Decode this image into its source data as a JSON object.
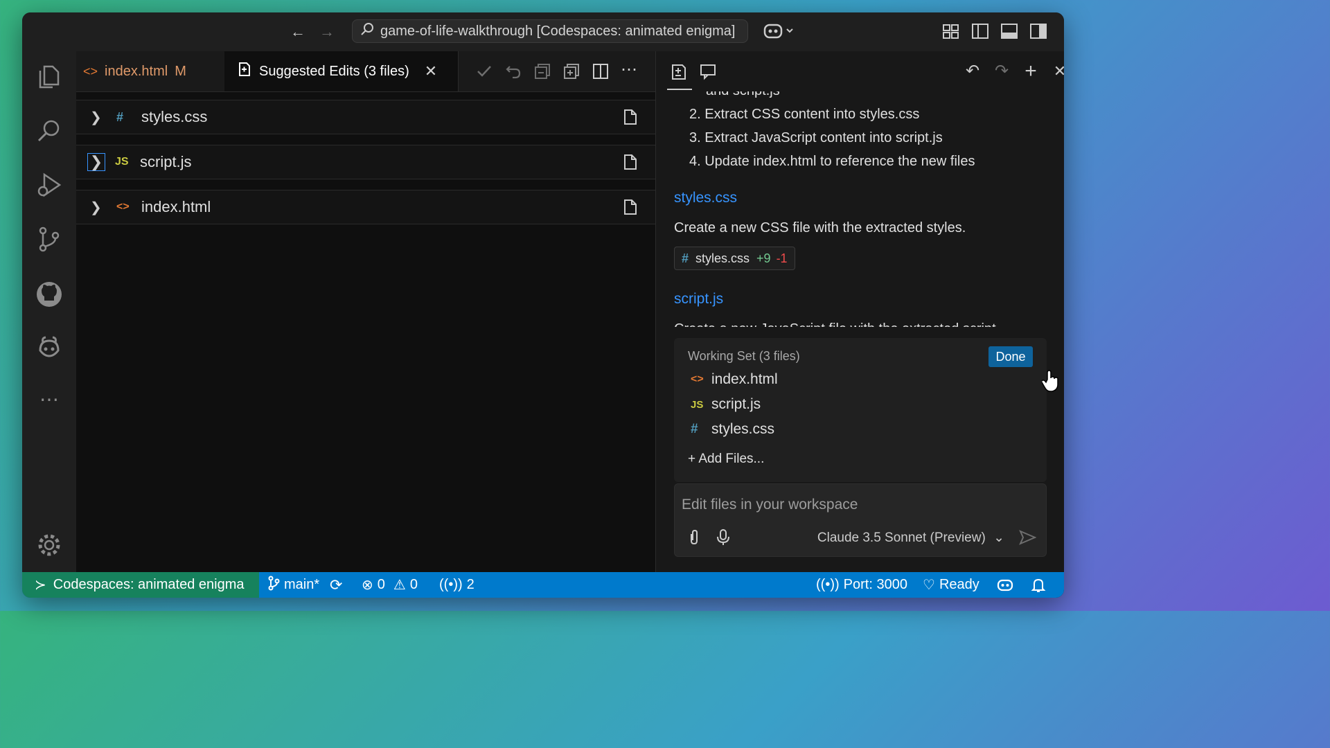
{
  "titlebar": {
    "search_text": "game-of-life-walkthrough [Codespaces: animated enigma]"
  },
  "tabs": [
    {
      "label": "index.html",
      "badge": "M"
    },
    {
      "label": "Suggested Edits (3 files)"
    }
  ],
  "files": [
    {
      "name": "styles.css",
      "icon": "#"
    },
    {
      "name": "script.js",
      "icon": "JS"
    },
    {
      "name": "index.html",
      "icon": "<>"
    }
  ],
  "chat": {
    "partial_top": "and script.js",
    "steps": [
      "2. Extract CSS content into styles.css",
      "3. Extract JavaScript content into script.js",
      "4. Update index.html to reference the new files"
    ],
    "section1_link": "styles.css",
    "section1_text": "Create a new CSS file with the extracted styles.",
    "pill": {
      "file": "styles.css",
      "hash": "#",
      "added": "+9",
      "removed": "-1"
    },
    "section2_link": "script.js",
    "section2_text": "Create a new JavaScript file with the extracted script",
    "working_set": {
      "title": "Working Set (3 files)",
      "done_label": "Done",
      "items": [
        {
          "name": "index.html",
          "icon": "<>"
        },
        {
          "name": "script.js",
          "icon": "JS"
        },
        {
          "name": "styles.css",
          "icon": "#"
        }
      ],
      "add_files": "+ Add Files..."
    },
    "input": {
      "placeholder": "Edit files in your workspace",
      "model": "Claude 3.5 Sonnet (Preview)"
    }
  },
  "statusbar": {
    "remote": "Codespaces: animated enigma",
    "branch": "main*",
    "errors": "0",
    "warnings": "0",
    "ports_count": "2",
    "port": "Port: 3000",
    "ready": "Ready"
  },
  "colors": {
    "accent": "#007acc",
    "remote": "#16825d",
    "link": "#3794ff",
    "done_button": "#0e639c"
  }
}
